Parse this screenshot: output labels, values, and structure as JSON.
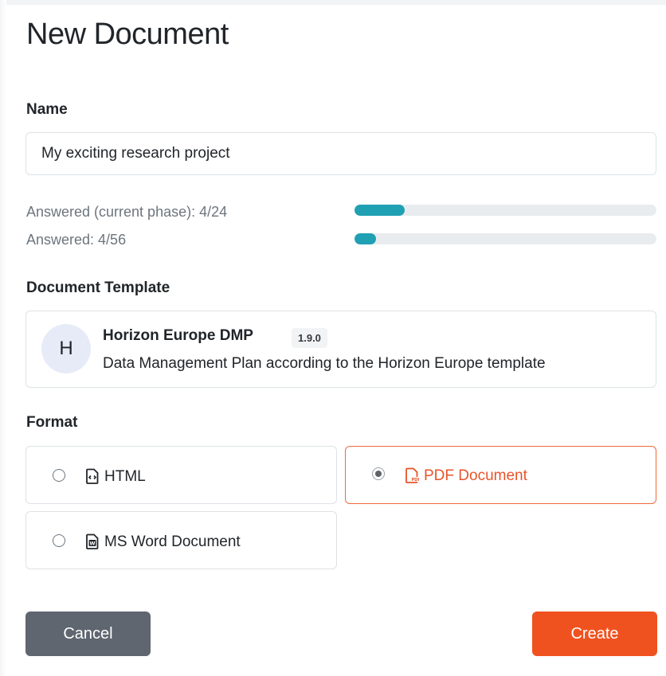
{
  "dialog": {
    "title": "New Document"
  },
  "name_field": {
    "label": "Name",
    "value": "My exciting research project"
  },
  "progress": [
    {
      "label": "Answered (current phase): 4/24",
      "fraction": 0.1667,
      "color": "#1fa0b3"
    },
    {
      "label": "Answered: 4/56",
      "fraction": 0.0714,
      "color": "#1fa0b3"
    }
  ],
  "template": {
    "label": "Document Template",
    "avatar_letter": "H",
    "name": "Horizon Europe DMP",
    "version": "1.9.0",
    "description": "Data Management Plan according to the Horizon Europe template"
  },
  "format": {
    "label": "Format",
    "options": [
      {
        "label": "HTML",
        "icon": "file-code-icon",
        "selected": false
      },
      {
        "label": "PDF Document",
        "icon": "file-pdf-icon",
        "selected": true
      },
      {
        "label": "MS Word Document",
        "icon": "file-word-icon",
        "selected": false
      }
    ]
  },
  "buttons": {
    "cancel": "Cancel",
    "create": "Create"
  },
  "colors": {
    "accent": "#f0521f",
    "progress": "#1fa0b3",
    "cancel": "#5f6670"
  }
}
